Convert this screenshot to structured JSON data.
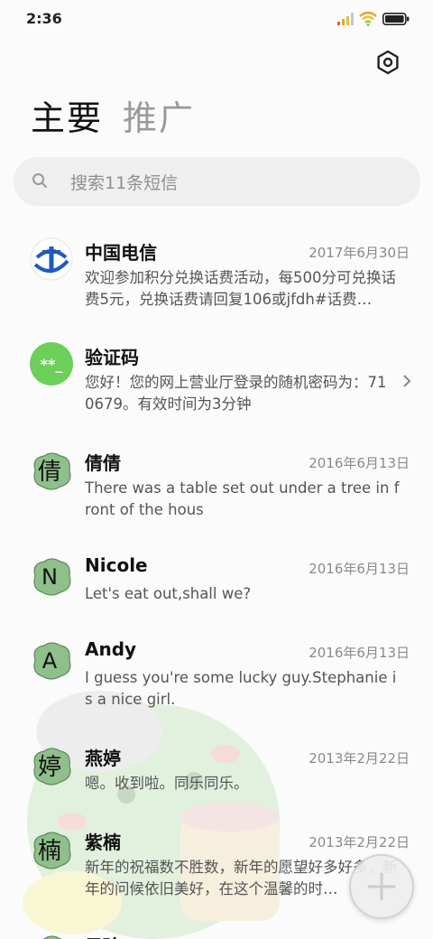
{
  "status_bar": {
    "time": "2:36"
  },
  "header": {
    "settings_icon": "settings-hexagon-icon",
    "tabs": [
      {
        "label": "主要",
        "active": true
      },
      {
        "label": "推广",
        "active": false
      }
    ]
  },
  "search": {
    "placeholder": "搜索11条短信"
  },
  "messages": [
    {
      "name": "中国电信",
      "date": "2017年6月30日",
      "preview": "欢迎参加积分兑换话费活动，每500分可兑换话费5元，兑换话费请回复106或jfdh#话费…",
      "avatar": "telecom-logo"
    },
    {
      "name": "验证码",
      "date": "",
      "preview": "您好！您的网上营业厅登录的随机密码为：710679。有效时间为3分钟",
      "avatar_text": "**_"
    },
    {
      "name": "倩倩",
      "date": "2016年6月13日",
      "preview": "There was a table set out under a tree in front of the hous",
      "avatar_text": "倩"
    },
    {
      "name": "Nicole",
      "date": "2016年6月13日",
      "preview": "Let's eat out,shall we?",
      "avatar_text": "N"
    },
    {
      "name": "Andy",
      "date": "2016年6月13日",
      "preview": "I guess you're some lucky guy.Stephanie is a nice girl.",
      "avatar_text": "A"
    },
    {
      "name": "燕婷",
      "date": "2013年2月22日",
      "preview": "嗯。收到啦。同乐同乐。",
      "avatar_text": "婷"
    },
    {
      "name": "紫楠",
      "date": "2013年2月22日",
      "preview": "新年的祝福数不胜数，新年的愿望好多好多，新年的问候依旧美好，在这个温馨的时…",
      "avatar_text": "楠"
    },
    {
      "name": "子玲",
      "date": "",
      "preview": "",
      "avatar_text": ""
    }
  ],
  "colors": {
    "accent_green": "#6ccf5a",
    "avatar_green": "#8fbf8a",
    "telecom_blue": "#1d5bbf"
  }
}
